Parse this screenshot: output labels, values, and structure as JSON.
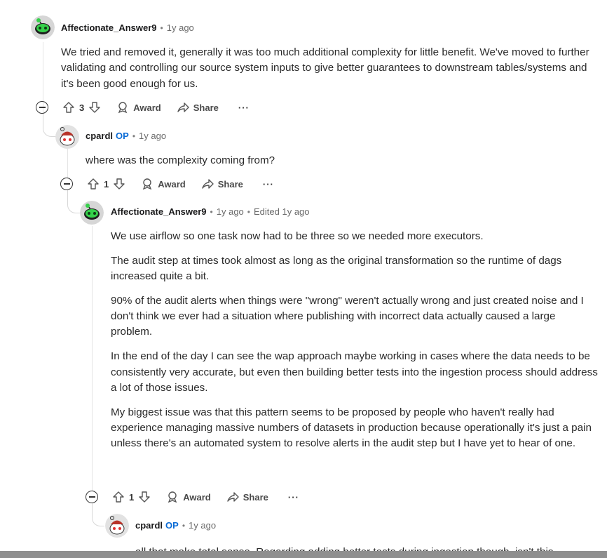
{
  "comments": [
    {
      "author": "Affectionate_Answer9",
      "op": "",
      "time": "1y ago",
      "edited": "",
      "avatar": "snoo-green-robot",
      "paragraphs": [
        "We tried and removed it, generally it was too much additional complexity for little benefit. We've moved to further validating and controlling our source system inputs to give better guarantees to downstream tables/systems and it's been good enough for us."
      ],
      "score": "3"
    },
    {
      "author": "cpardl",
      "op": "OP",
      "time": "1y ago",
      "edited": "",
      "avatar": "snoo-red-hat",
      "paragraphs": [
        "where was the complexity coming from?"
      ],
      "score": "1"
    },
    {
      "author": "Affectionate_Answer9",
      "op": "",
      "time": "1y ago",
      "edited": "Edited 1y ago",
      "avatar": "snoo-green-robot",
      "paragraphs": [
        "We use airflow so one task now had to be three so we needed more executors.",
        "The audit step at times took almost as long as the original transformation so the runtime of dags increased quite a bit.",
        "90% of the audit alerts when things were \"wrong\" weren't actually wrong and just created noise and I don't think we ever had a situation where publishing with incorrect data actually caused a large problem.",
        "In the end of the day I can see the wap approach maybe working in cases where the data needs to be consistently very accurate, but even then building better tests into the ingestion process should address a lot of those issues.",
        "My biggest issue was that this pattern seems to be proposed by people who haven't really had experience managing massive numbers of datasets in production because operationally it's just a pain unless there's an automated system to resolve alerts in the audit step but I have yet to hear of one."
      ],
      "score": "1"
    },
    {
      "author": "cpardl",
      "op": "OP",
      "time": "1y ago",
      "edited": "",
      "avatar": "snoo-red-hat",
      "paragraphs": [
        "all that make total sense. Regarding adding better tests during ingestion though, isn't this"
      ],
      "score": ""
    }
  ],
  "actions": {
    "award_label": "Award",
    "share_label": "Share",
    "more_label": "···"
  },
  "colors": {
    "op_badge": "#0a6bd6",
    "text": "#1a1a1b",
    "muted": "#6a6a6a",
    "bottom_bar": "#8f8f8f"
  }
}
